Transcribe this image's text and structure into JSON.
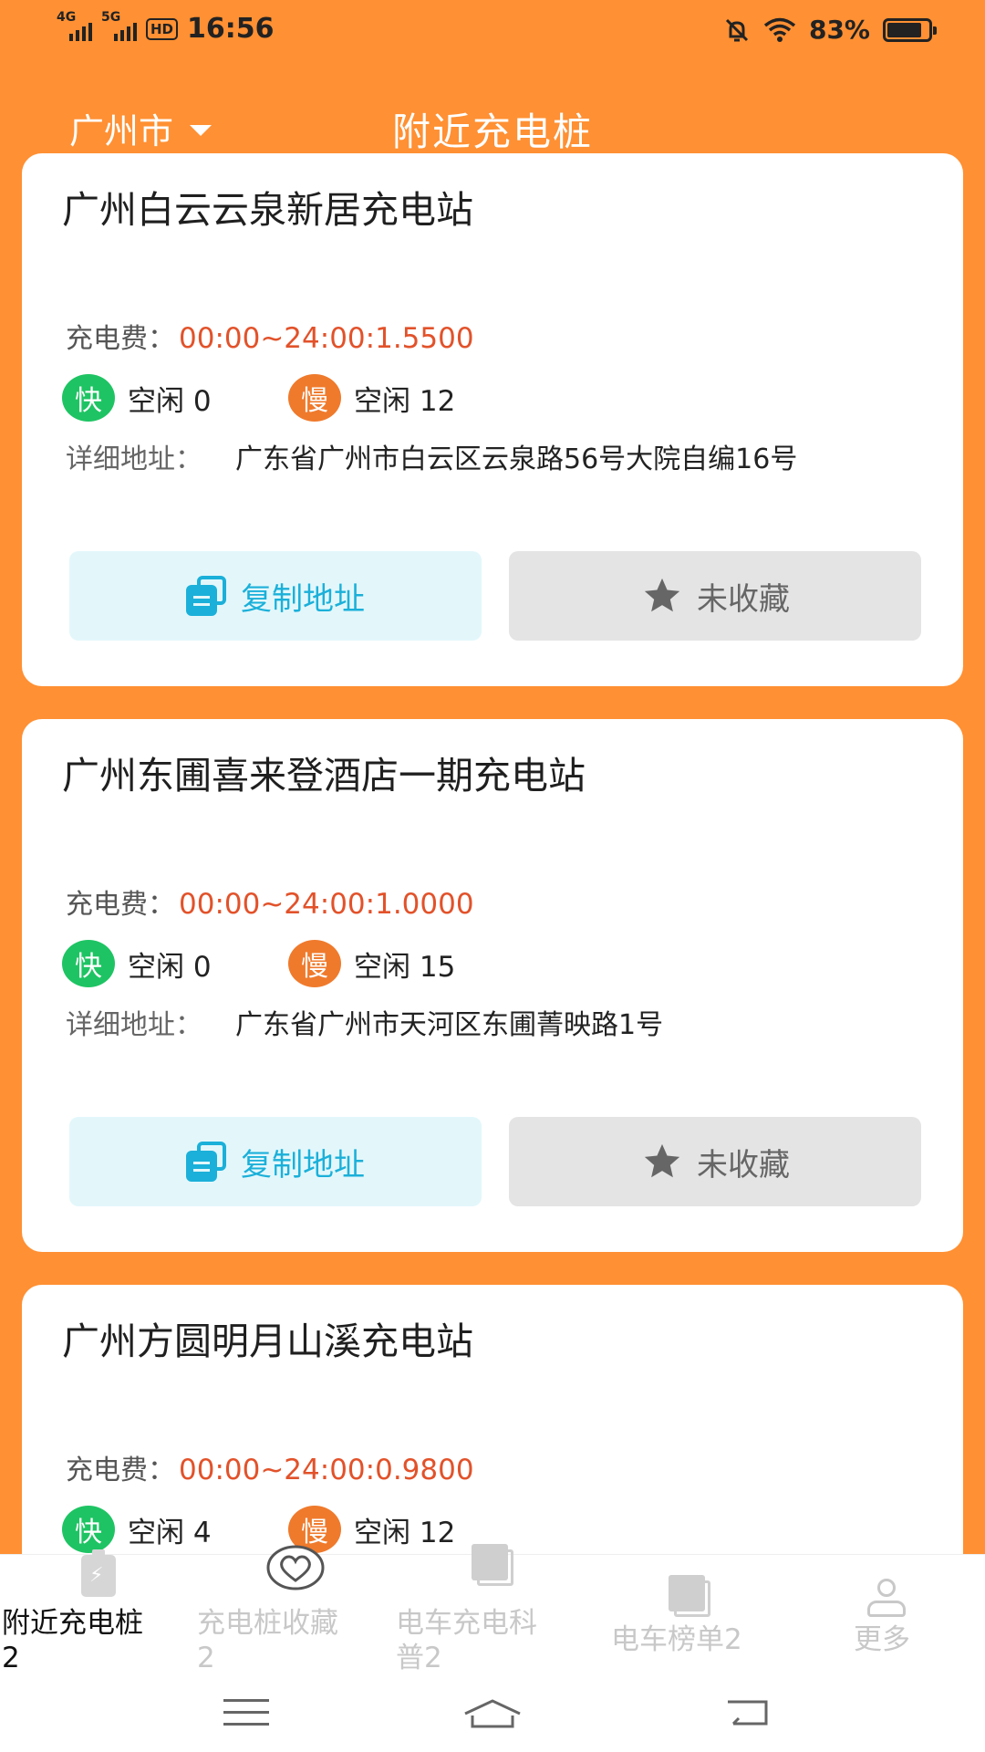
{
  "status_bar": {
    "sim1_label": "4G",
    "sim2_label": "5G",
    "hd_label": "HD",
    "time": "16:56",
    "battery_percent": "83%",
    "battery_level": 0.83
  },
  "header": {
    "city": "广州市",
    "title": "附近充电桩"
  },
  "labels": {
    "fee": "充电费：",
    "fast": "快",
    "slow": "慢",
    "address": "详细地址：",
    "copy_button": "复制地址",
    "fav_button": "未收藏"
  },
  "stations": [
    {
      "name": "广州白云云泉新居充电站",
      "fee": "00:00~24:00:1.5500",
      "fast_free": "空闲 0",
      "slow_free": "空闲 12",
      "address": "广东省广州市白云区云泉路56号大院自编16号"
    },
    {
      "name": "广州东圃喜来登酒店一期充电站",
      "fee": "00:00~24:00:1.0000",
      "fast_free": "空闲 0",
      "slow_free": "空闲 15",
      "address": "广东省广州市天河区东圃菁映路1号"
    },
    {
      "name": "广州方圆明月山溪充电站",
      "fee": "00:00~24:00:0.9800",
      "fast_free": "空闲 4",
      "slow_free": "空闲 12",
      "address": ""
    }
  ],
  "tabs": [
    {
      "label_line1": "附近充电桩",
      "label_line2": "2",
      "active": true
    },
    {
      "label_line1": "充电桩收藏",
      "label_line2": "2",
      "active": false
    },
    {
      "label_line1": "电车充电科",
      "label_line2": "普2",
      "active": false
    },
    {
      "label_line1": "电车榜单2",
      "label_line2": "",
      "active": false
    },
    {
      "label_line1": "更多",
      "label_line2": "",
      "active": false
    }
  ],
  "colors": {
    "background": "#ff9033",
    "fee_text": "#e2522a",
    "fast_badge": "#1ec463",
    "slow_badge": "#ef7a2c",
    "copy_button_bg": "#e3f7fb",
    "copy_button_text": "#1bb0d9",
    "fav_button_bg": "#e4e4e4"
  }
}
